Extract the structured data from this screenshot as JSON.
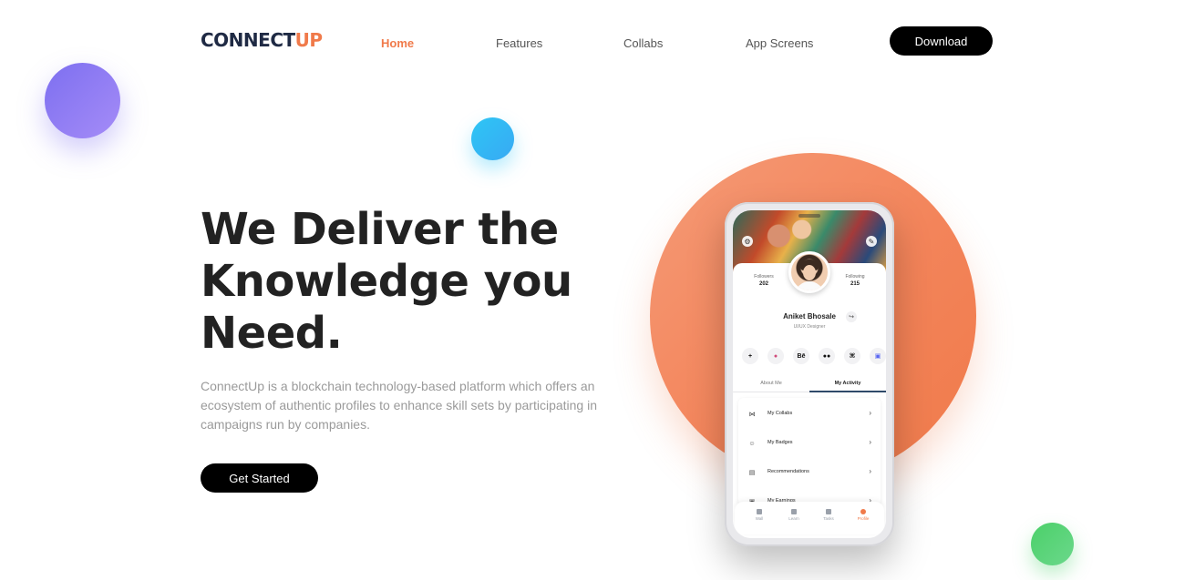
{
  "brand": {
    "logo_main": "CONNECT",
    "logo_accent": "UP"
  },
  "nav": {
    "items": [
      {
        "label": "Home",
        "active": true
      },
      {
        "label": "Features",
        "active": false
      },
      {
        "label": "Collabs",
        "active": false
      },
      {
        "label": "App Screens",
        "active": false
      }
    ],
    "download_label": "Download"
  },
  "hero": {
    "title_line1": "We Deliver the",
    "title_bold": "Knowledge",
    "title_after_bold": " you",
    "title_line3": "Need.",
    "description": "ConnectUp is a blockchain technology-based platform which offers an ecosystem of authentic profiles to enhance skill sets by participating in campaigns run by companies.",
    "cta_label": "Get Started"
  },
  "phone": {
    "followers_label": "Followers",
    "followers_value": "202",
    "following_label": "Following",
    "following_value": "215",
    "name": "Aniket Bhosale",
    "role": "UI/UX Designer",
    "socials": [
      "+",
      "●",
      "Bē",
      "●●",
      "⌘",
      "▣"
    ],
    "tabs": [
      "About Me",
      "My Activity"
    ],
    "active_tab": "My Activity",
    "list_items": [
      {
        "icon": "⋈",
        "label": "My Collabs"
      },
      {
        "icon": "☺",
        "label": "My Badges"
      },
      {
        "icon": "▤",
        "label": "Recommendations"
      },
      {
        "icon": "▣",
        "label": "My Earnings"
      }
    ],
    "bottom_nav": [
      {
        "label": "Wall",
        "active": false
      },
      {
        "label": "Learn",
        "active": false
      },
      {
        "label": "Tasks",
        "active": false
      },
      {
        "label": "Profile",
        "active": true
      }
    ]
  },
  "colors": {
    "accent": "#f07a4a",
    "purple": "#7d6ff0",
    "blue": "#2ec6f5",
    "green": "#4bd069"
  }
}
